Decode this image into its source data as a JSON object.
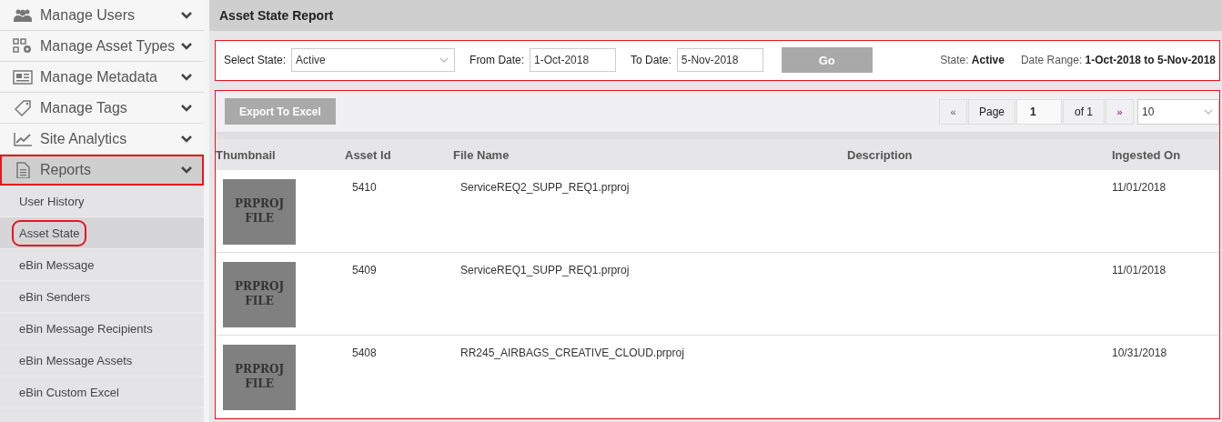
{
  "sidebar": {
    "items": [
      {
        "label": "Manage Users",
        "expanded": false,
        "highlighted": false
      },
      {
        "label": "Manage Asset Types",
        "expanded": false,
        "highlighted": false
      },
      {
        "label": "Manage Metadata",
        "expanded": false,
        "highlighted": false
      },
      {
        "label": "Manage Tags",
        "expanded": false,
        "highlighted": false
      },
      {
        "label": "Site Analytics",
        "expanded": false,
        "highlighted": false
      },
      {
        "label": "Reports",
        "expanded": true,
        "highlighted": true,
        "children": [
          {
            "label": "User History",
            "selected": false,
            "highlighted": false
          },
          {
            "label": "Asset State",
            "selected": true,
            "highlighted": true
          },
          {
            "label": "eBin Message",
            "selected": false,
            "highlighted": false
          },
          {
            "label": "eBin Senders",
            "selected": false,
            "highlighted": false
          },
          {
            "label": "eBin Message Recipients",
            "selected": false,
            "highlighted": false
          },
          {
            "label": "eBin Message Assets",
            "selected": false,
            "highlighted": false
          },
          {
            "label": "eBin Custom Excel",
            "selected": false,
            "highlighted": false
          }
        ]
      }
    ]
  },
  "page_title": "Asset State Report",
  "filters": {
    "highlighted": true,
    "state_label": "Select State:",
    "state_value": "Active",
    "from_label": "From Date:",
    "from_value": "1-Oct-2018",
    "to_label": "To Date:",
    "to_value": "5-Nov-2018",
    "go_button": "Go",
    "summary_state_label": "State:",
    "summary_state": "Active",
    "summary_range_label": "Date Range:",
    "summary_range": "1-Oct-2018 to 5-Nov-2018"
  },
  "results": {
    "highlighted": true,
    "export_button": "Export To Excel",
    "pager": {
      "first": "«",
      "page_label": "Page",
      "page": "1",
      "of": "of 1",
      "next": "»",
      "page_size": "10"
    },
    "table": {
      "columns": [
        "Thumbnail",
        "Asset Id",
        "File Name",
        "Description",
        "Ingested On"
      ],
      "rows": [
        {
          "thumbnail": "PRPROJ FILE",
          "asset_id": "5410",
          "file_name": "ServiceREQ2_SUPP_REQ1.prproj",
          "ingested_on": "11/01/2018"
        },
        {
          "thumbnail": "PRPROJ FILE",
          "asset_id": "5409",
          "file_name": "ServiceREQ1_SUPP_REQ1.prproj",
          "ingested_on": "11/01/2018"
        },
        {
          "thumbnail": "PRPROJ FILE",
          "asset_id": "5408",
          "file_name": "RR245_AIRBAGS_CREATIVE_CLOUD.prproj",
          "ingested_on": "10/31/2018"
        }
      ]
    }
  }
}
